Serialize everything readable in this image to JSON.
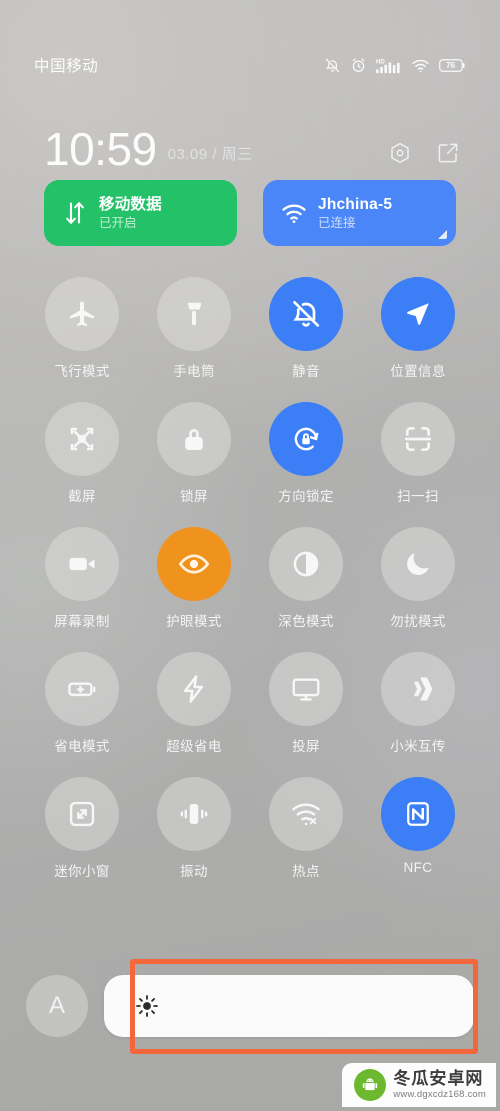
{
  "status_bar": {
    "carrier": "中国移动",
    "icons": [
      "bell-off-icon",
      "alarm-icon",
      "hd-signal-icon",
      "wifi-icon",
      "battery-icon"
    ],
    "battery_percent": "76"
  },
  "clock": {
    "time": "10:59",
    "date": "03.09 / 周三",
    "actions": [
      "settings-icon",
      "edit-icon"
    ]
  },
  "connection_cards": [
    {
      "icon": "mobile-data-icon",
      "title": "移动数据",
      "subtitle": "已开启",
      "color": "#23c268",
      "state": "on",
      "has_corner_expand": false
    },
    {
      "icon": "wifi-icon",
      "title": "Jhchina-5",
      "subtitle": "已连接",
      "color": "#4a86f7",
      "state": "connected",
      "has_corner_expand": true
    }
  ],
  "toggles": [
    {
      "icon": "airplane-icon",
      "label": "飞行模式",
      "state": "off"
    },
    {
      "icon": "flashlight-icon",
      "label": "手电筒",
      "state": "off"
    },
    {
      "icon": "bell-off-icon",
      "label": "静音",
      "state": "on"
    },
    {
      "icon": "location-icon",
      "label": "位置信息",
      "state": "on"
    },
    {
      "icon": "screenshot-icon",
      "label": "截屏",
      "state": "off"
    },
    {
      "icon": "lock-icon",
      "label": "锁屏",
      "state": "off"
    },
    {
      "icon": "rotation-lock-icon",
      "label": "方向锁定",
      "state": "on"
    },
    {
      "icon": "scan-icon",
      "label": "扫一扫",
      "state": "off"
    },
    {
      "icon": "screen-record-icon",
      "label": "屏幕录制",
      "state": "off"
    },
    {
      "icon": "eye-care-icon",
      "label": "护眼模式",
      "state": "on-orange"
    },
    {
      "icon": "dark-mode-icon",
      "label": "深色模式",
      "state": "off"
    },
    {
      "icon": "do-not-disturb-icon",
      "label": "勿扰模式",
      "state": "off"
    },
    {
      "icon": "battery-saver-icon",
      "label": "省电模式",
      "state": "off"
    },
    {
      "icon": "ultra-battery-icon",
      "label": "超级省电",
      "state": "off"
    },
    {
      "icon": "cast-icon",
      "label": "投屏",
      "state": "off"
    },
    {
      "icon": "mi-share-icon",
      "label": "小米互传",
      "state": "off"
    },
    {
      "icon": "mini-window-icon",
      "label": "迷你小窗",
      "state": "off"
    },
    {
      "icon": "vibrate-icon",
      "label": "振动",
      "state": "off"
    },
    {
      "icon": "hotspot-icon",
      "label": "热点",
      "state": "off"
    },
    {
      "icon": "nfc-icon",
      "label": "NFC",
      "state": "on"
    }
  ],
  "brightness": {
    "auto_label": "A",
    "slider_icon": "brightness-sun-icon",
    "value_percent": 100
  },
  "annotation": {
    "color": "#f4673a",
    "target": "brightness-slider"
  },
  "watermark": {
    "title": "冬瓜安卓网",
    "url": "www.dgxcdz168.com"
  },
  "colors": {
    "accent_blue": "#3b7ef5",
    "accent_orange": "#f0921e",
    "card_green": "#23c268",
    "card_blue": "#4a86f7",
    "annotation_orange": "#f4673a",
    "background_gray": "#b2b2b1"
  }
}
